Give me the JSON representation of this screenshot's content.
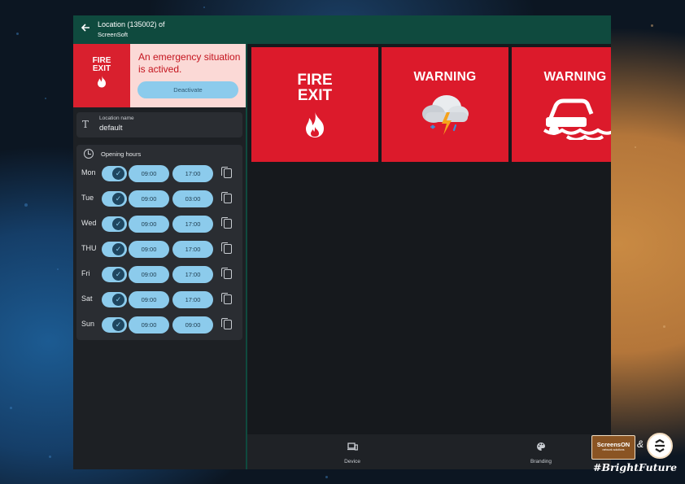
{
  "header": {
    "title_line1": "Location (135002) of",
    "title_line2": "ScreenSoft",
    "back_icon": "arrow-left-icon"
  },
  "alert": {
    "image_text_line1": "FIRE",
    "image_text_line2": "EXIT",
    "message": "An emergency situation is actived.",
    "button_label": "Deactivate",
    "background_color": "#fbd9d6",
    "text_color": "#c4141e"
  },
  "location": {
    "label": "Location name",
    "value": "default",
    "icon": "text-icon"
  },
  "opening_hours": {
    "title": "Opening hours",
    "icon": "clock-icon",
    "days": [
      {
        "day": "Mon",
        "enabled": true,
        "open": "09:00",
        "close": "17:00"
      },
      {
        "day": "Tue",
        "enabled": true,
        "open": "09:00",
        "close": "03:00"
      },
      {
        "day": "Wed",
        "enabled": true,
        "open": "09:00",
        "close": "17:00"
      },
      {
        "day": "THU",
        "enabled": true,
        "open": "09:00",
        "close": "17:00"
      },
      {
        "day": "Fri",
        "enabled": true,
        "open": "09:00",
        "close": "17:00"
      },
      {
        "day": "Sat",
        "enabled": true,
        "open": "09:00",
        "close": "17:00"
      },
      {
        "day": "Sun",
        "enabled": true,
        "open": "09:00",
        "close": "09:00"
      }
    ]
  },
  "tiles": [
    {
      "kind": "fire-exit",
      "line1": "FIRE",
      "line2": "EXIT",
      "icon": "flame-icon"
    },
    {
      "kind": "warning-storm",
      "title": "WARNING",
      "icon": "storm-cloud-icon"
    },
    {
      "kind": "warning-flood",
      "title": "WARNING",
      "icon": "flooded-car-icon"
    }
  ],
  "bottom_nav": {
    "device_label": "Device",
    "branding_label": "Branding"
  },
  "badge": {
    "brand": "ScreensON",
    "brand_sub": "network solutions",
    "ampersand": "&",
    "hashtag": "#BrightFuture"
  },
  "colors": {
    "header": "#0f4a3e",
    "accent": "#8ccbec",
    "tile_red": "#dc1a2b"
  }
}
